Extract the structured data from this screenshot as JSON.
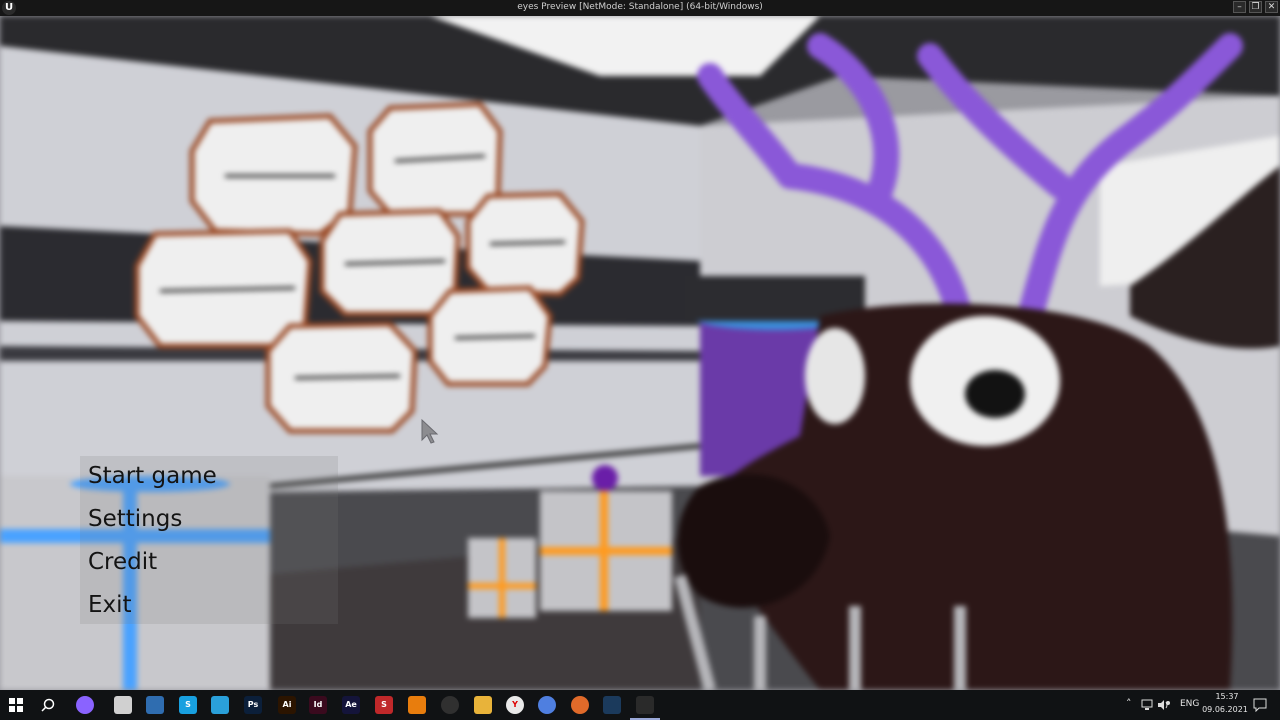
{
  "window": {
    "title": "eyes Preview [NetMode: Standalone]  (64-bit/Windows)",
    "logo_icon": "unreal-engine-icon",
    "controls": [
      "minimize-icon",
      "restore-icon",
      "close-icon"
    ]
  },
  "menu": {
    "items": [
      {
        "label": "Start game"
      },
      {
        "label": "Settings"
      },
      {
        "label": "Credit"
      },
      {
        "label": "Exit"
      }
    ]
  },
  "taskbar": {
    "start_icon": "windows-start-icon",
    "search_icon": "search-icon",
    "apps": [
      {
        "icon": "cortana-icon",
        "text": "",
        "color": "#8a63ff"
      },
      {
        "icon": "browser-icon",
        "text": "",
        "color": "#d0d0d0"
      },
      {
        "icon": "calculator-icon",
        "text": "",
        "color": "#2f6db0"
      },
      {
        "icon": "skype-icon",
        "text": "S",
        "color": "#18a0e0"
      },
      {
        "icon": "telegram-icon",
        "text": "",
        "color": "#2aa0da"
      },
      {
        "icon": "photoshop-icon",
        "text": "Ps",
        "color": "#0b1f3a"
      },
      {
        "icon": "illustrator-icon",
        "text": "Ai",
        "color": "#2b1400"
      },
      {
        "icon": "indesign-icon",
        "text": "Id",
        "color": "#3a0a1e"
      },
      {
        "icon": "after-effects-icon",
        "text": "Ae",
        "color": "#14143a"
      },
      {
        "icon": "substance-icon",
        "text": "S",
        "color": "#c0282a"
      },
      {
        "icon": "blender-icon",
        "text": "",
        "color": "#e87d0d"
      },
      {
        "icon": "obs-icon",
        "text": "",
        "color": "#303030"
      },
      {
        "icon": "file-explorer-icon",
        "text": "",
        "color": "#e8b33a"
      },
      {
        "icon": "yandex-browser-icon",
        "text": "Y",
        "color": "#e9e9e9"
      },
      {
        "icon": "chrome-icon",
        "text": "",
        "color": "#4f7fe0"
      },
      {
        "icon": "settings-gear-icon",
        "text": "",
        "color": "#e06a2a"
      },
      {
        "icon": "steam-icon",
        "text": "",
        "color": "#1b3a5c"
      },
      {
        "icon": "unreal-engine-icon",
        "text": "",
        "color": "#2a2a2a"
      }
    ],
    "tray": {
      "chevron_icon": "chevron-up-icon",
      "icons": [
        "network-icon",
        "volume-icon",
        "vpn-icon"
      ],
      "language": "ENG",
      "time": "15:37",
      "date": "09.06.2021",
      "notification_icon": "notification-icon"
    }
  }
}
